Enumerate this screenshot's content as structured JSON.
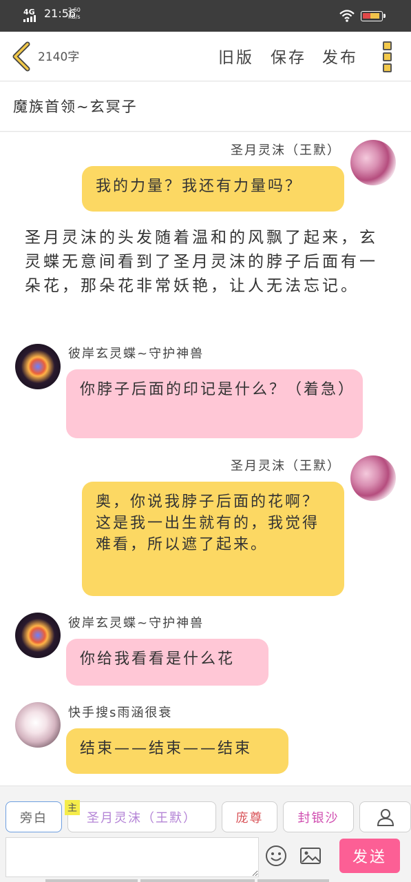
{
  "status_bar": {
    "network": "4G",
    "time": "21:56",
    "speed_value": "2.60",
    "speed_unit": "KB/s"
  },
  "toolbar": {
    "word_count": "2140字",
    "old_version": "旧版",
    "save": "保存",
    "publish": "发布"
  },
  "chapter_title": "魔族首领~玄冥子",
  "messages": [
    {
      "type": "speaker",
      "side": "right",
      "name": "圣月灵沫（王默）",
      "text": "我的力量？我还有力量吗？",
      "color": "yellow"
    },
    {
      "type": "narration",
      "text": "圣月灵沫的头发随着温和的风飘了起来，玄灵蝶无意间看到了圣月灵沫的脖子后面有一朵花，那朵花非常妖艳，让人无法忘记。"
    },
    {
      "type": "speaker",
      "side": "left",
      "name": "彼岸玄灵蝶~守护神兽",
      "text": "你脖子后面的印记是什么？（着急）",
      "color": "pink"
    },
    {
      "type": "speaker",
      "side": "right",
      "name": "圣月灵沫（王默）",
      "text": "奥，你说我脖子后面的花啊？这是我一出生就有的，我觉得难看，所以遮了起来。",
      "color": "yellow"
    },
    {
      "type": "speaker",
      "side": "left",
      "name": "彼岸玄灵蝶~守护神兽",
      "text": "你给我看看是什么花",
      "color": "pink"
    },
    {
      "type": "speaker",
      "side": "left",
      "name": "快手搜s雨涵很衰",
      "text": "结束——结束——结束",
      "color": "yellow"
    }
  ],
  "roles": {
    "narrator": "旁白",
    "main_badge": "主",
    "main_role": "圣月灵沫（王默）",
    "role3": "庞尊",
    "role4": "封银沙"
  },
  "composer": {
    "placeholder": "",
    "send": "发送"
  }
}
